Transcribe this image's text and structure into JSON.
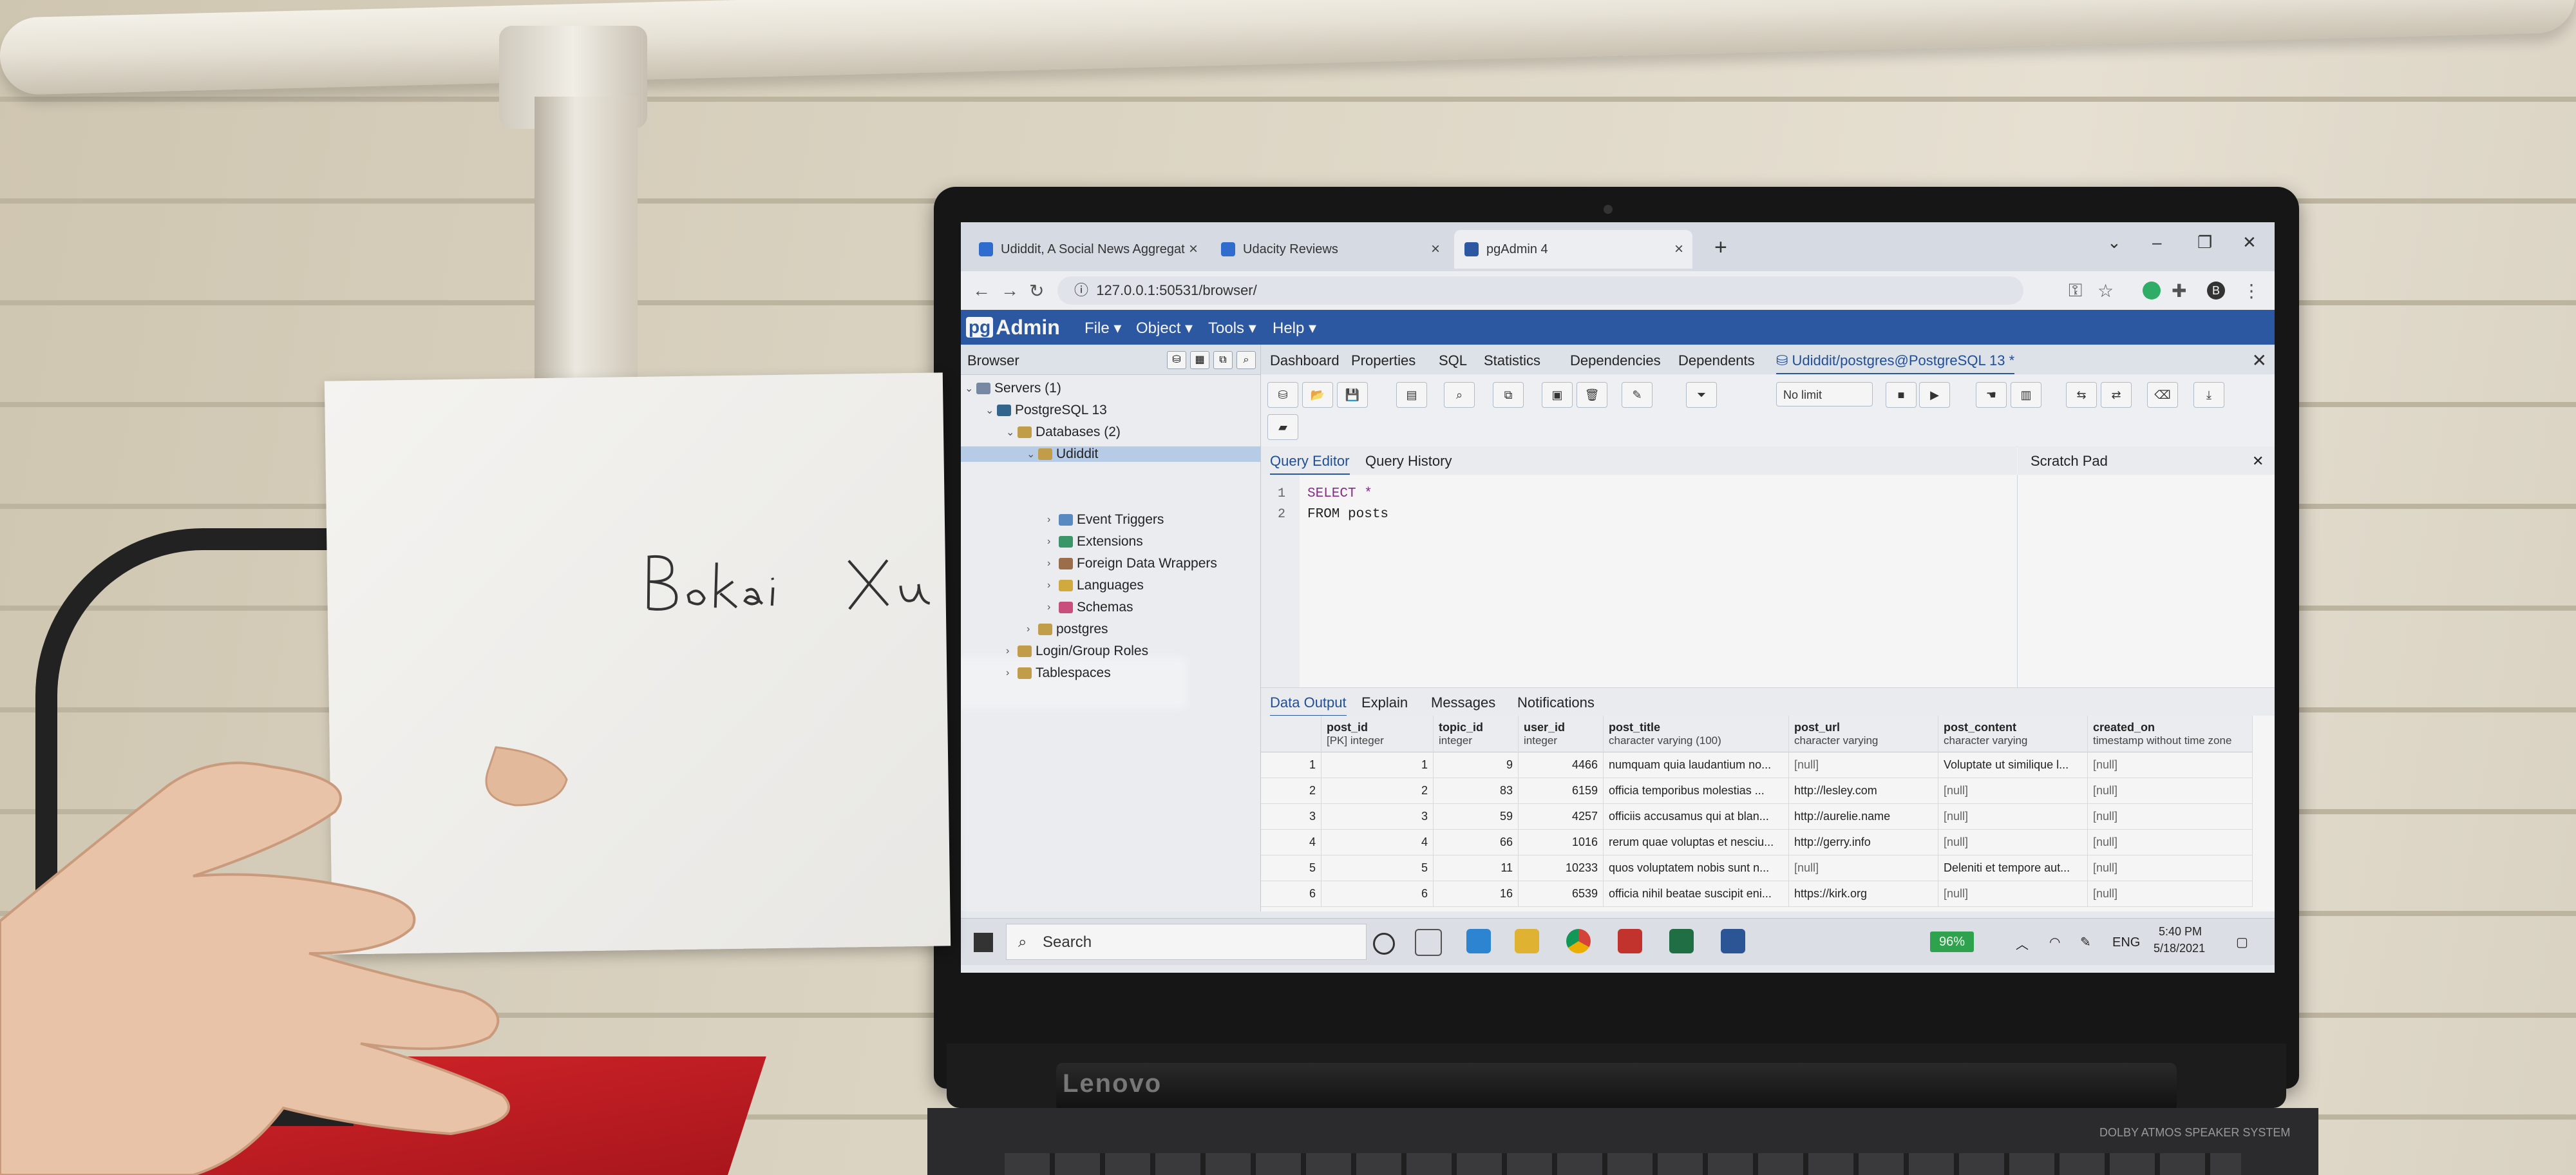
{
  "browser": {
    "tabs": [
      {
        "title": "Udiddit, A Social News Aggregat",
        "favicon_color": "#2f6fd6"
      },
      {
        "title": "Udacity Reviews",
        "favicon_color": "#2f6fd6"
      },
      {
        "title": "pgAdmin 4",
        "favicon_color": "#2b5aa6",
        "active": true
      }
    ],
    "url": "127.0.0.1:50531/browser/",
    "profile_initial": "B"
  },
  "pgadmin": {
    "logo_prefix": "pg",
    "logo_suffix": "Admin",
    "menu": [
      "File",
      "Object",
      "Tools",
      "Help"
    ],
    "browser_panel": {
      "title": "Browser",
      "tree": [
        {
          "label": "Servers (1)",
          "icon_color": "#7a8ca8"
        },
        {
          "label": "PostgreSQL 13",
          "icon_color": "#336791"
        },
        {
          "label": "Databases (2)",
          "icon_color": "#c8a24a"
        },
        {
          "label": "Udiddit",
          "icon_color": "#c8a24a",
          "selected": true
        },
        {
          "label": "Event Triggers",
          "icon_color": "#5a8fc8"
        },
        {
          "label": "Extensions",
          "icon_color": "#3a9a6a"
        },
        {
          "label": "Foreign Data Wrappers",
          "icon_color": "#a0714a"
        },
        {
          "label": "Languages",
          "icon_color": "#d8b040"
        },
        {
          "label": "Schemas",
          "icon_color": "#d05080"
        },
        {
          "label": "postgres",
          "icon_color": "#c8a24a"
        },
        {
          "label": "Login/Group Roles",
          "icon_color": "#c8a24a"
        },
        {
          "label": "Tablespaces",
          "icon_color": "#c8a24a"
        }
      ]
    },
    "main_tabs": [
      "Dashboard",
      "Properties",
      "SQL",
      "Statistics",
      "Dependencies",
      "Dependents"
    ],
    "query_tab": "Udiddit/postgres@PostgreSQL 13 *",
    "toolbar": {
      "limit": "No limit"
    },
    "editor_tabs": [
      "Query Editor",
      "Query History"
    ],
    "scratch_pad": "Scratch Pad",
    "code": [
      {
        "line": "1",
        "text": "SELECT *"
      },
      {
        "line": "2",
        "text": "FROM posts"
      }
    ],
    "output_tabs": [
      "Data Output",
      "Explain",
      "Messages",
      "Notifications"
    ],
    "grid": {
      "columns": [
        {
          "name": "post_id",
          "type": "[PK] integer"
        },
        {
          "name": "topic_id",
          "type": "integer"
        },
        {
          "name": "user_id",
          "type": "integer"
        },
        {
          "name": "post_title",
          "type": "character varying (100)"
        },
        {
          "name": "post_url",
          "type": "character varying"
        },
        {
          "name": "post_content",
          "type": "character varying"
        },
        {
          "name": "created_on",
          "type": "timestamp without time zone"
        }
      ],
      "rows": [
        [
          "1",
          "1",
          "9",
          "4466",
          "numquam quia laudantium no...",
          "[null]",
          "Voluptate ut similique l...",
          "[null]"
        ],
        [
          "2",
          "2",
          "83",
          "6159",
          "officia temporibus molestias ...",
          "http://lesley.com",
          "[null]",
          "[null]"
        ],
        [
          "3",
          "3",
          "59",
          "4257",
          "officiis accusamus qui at blan...",
          "http://aurelie.name",
          "[null]",
          "[null]"
        ],
        [
          "4",
          "4",
          "66",
          "1016",
          "rerum quae voluptas et nesciu...",
          "http://gerry.info",
          "[null]",
          "[null]"
        ],
        [
          "5",
          "5",
          "11",
          "10233",
          "quos voluptatem nobis sunt n...",
          "[null]",
          "Deleniti et tempore aut...",
          "[null]"
        ],
        [
          "6",
          "6",
          "16",
          "6539",
          "officia nihil beatae suscipit eni...",
          "https://kirk.org",
          "[null]",
          "[null]"
        ]
      ]
    }
  },
  "taskbar": {
    "search": "Search",
    "battery": "96%",
    "lang": "ENG",
    "time": "5:40 PM",
    "date": "5/18/2021"
  },
  "scene": {
    "handwritten_name": "Bokai Xu",
    "laptop_brand": "Lenovo",
    "speaker_badge": "DOLBY ATMOS SPEAKER SYSTEM"
  }
}
